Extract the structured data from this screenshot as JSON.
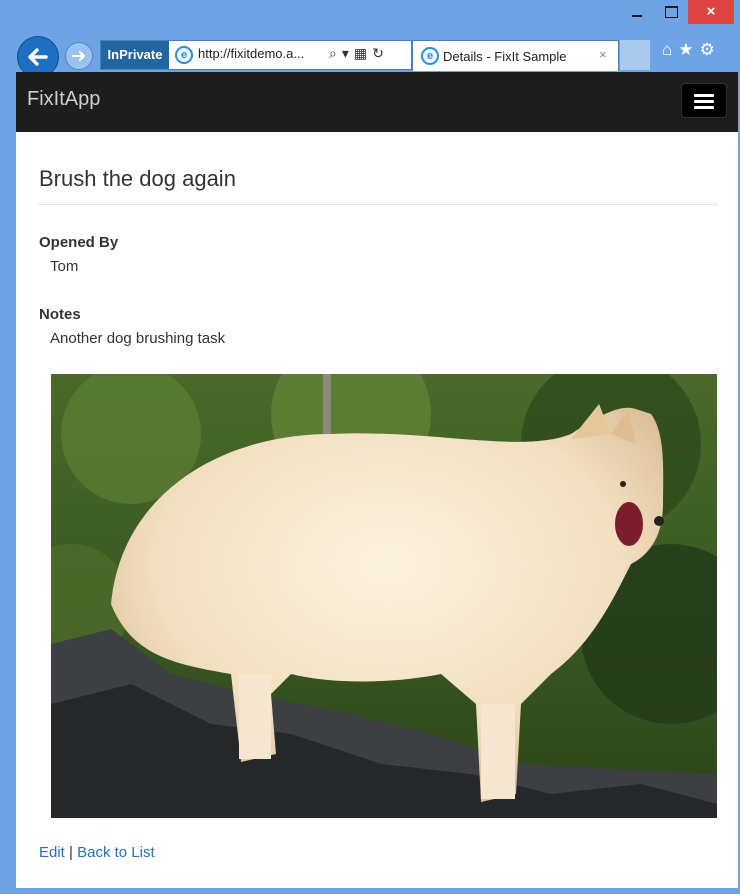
{
  "browser": {
    "inprivate_label": "InPrivate",
    "url": "http://fixitdemo.a...",
    "tab_title": "Details - FixIt Sample",
    "tab_close": "×",
    "window_min": "",
    "window_max": "",
    "window_close": "×"
  },
  "icons": {
    "back": "back-arrow-icon",
    "forward": "forward-arrow-icon",
    "ie": "ie-logo-icon",
    "search": "search-icon",
    "compat": "compatibility-view-icon",
    "refresh": "refresh-icon",
    "home": "home-icon",
    "favorites": "star-icon",
    "settings": "gear-icon",
    "menu": "hamburger-icon"
  },
  "app": {
    "brand": "FixItApp"
  },
  "task": {
    "title": "Brush the dog again",
    "opened_by_label": "Opened By",
    "opened_by_value": "Tom",
    "notes_label": "Notes",
    "notes_value": "Another dog brushing task"
  },
  "links": {
    "edit": "Edit",
    "separator": " | ",
    "back_to_list": "Back to List"
  },
  "colors": {
    "navbar": "#1d1d1d",
    "link": "#2a6fb3",
    "browser_frame": "#6ea3e6",
    "close_button": "#e04343"
  }
}
